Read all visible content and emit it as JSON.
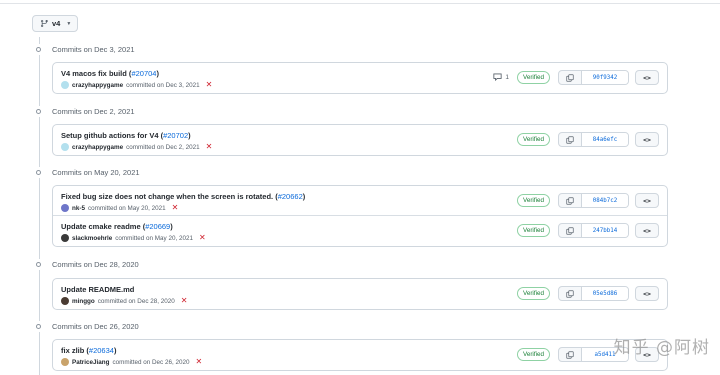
{
  "branch": {
    "label": "v4"
  },
  "groups": [
    {
      "date": "Commits on Dec 3, 2021",
      "commits": [
        {
          "title": "V4 macos fix build (",
          "pr": "#20704",
          "close": ")",
          "author": "crazyhappygame",
          "committed": "committed on Dec 3, 2021",
          "comments": "1",
          "verified": "Verified",
          "sha": "90f9342",
          "browse": "<>"
        }
      ]
    },
    {
      "date": "Commits on Dec 2, 2021",
      "commits": [
        {
          "title": "Setup github actions for V4 (",
          "pr": "#20702",
          "close": ")",
          "author": "crazyhappygame",
          "committed": "committed on Dec 2, 2021",
          "verified": "Verified",
          "sha": "84a6efc",
          "browse": "<>"
        }
      ]
    },
    {
      "date": "Commits on May 20, 2021",
      "commits": [
        {
          "title": "Fixed bug size does not change when the screen is rotated. (",
          "pr": "#20662",
          "close": ")",
          "author": "nk-5",
          "committed": "committed on May 20, 2021",
          "verified": "Verified",
          "sha": "084b7c2",
          "browse": "<>"
        },
        {
          "title": "Update cmake readme (",
          "pr": "#20669",
          "close": ")",
          "author": "slackmoehrle",
          "committed": "committed on May 20, 2021",
          "verified": "Verified",
          "sha": "247bb14",
          "browse": "<>"
        }
      ]
    },
    {
      "date": "Commits on Dec 28, 2020",
      "commits": [
        {
          "title": "Update README.md",
          "pr": "",
          "close": "",
          "author": "minggo",
          "committed": "committed on Dec 28, 2020",
          "verified": "Verified",
          "sha": "05e5d86",
          "browse": "<>"
        }
      ]
    },
    {
      "date": "Commits on Dec 26, 2020",
      "commits": [
        {
          "title": "fix zlib (",
          "pr": "#20634",
          "close": ")",
          "author": "PatriceJiang",
          "committed": "committed on Dec 26, 2020",
          "verified": "Verified",
          "sha": "a5d411",
          "browse": "<>"
        }
      ]
    }
  ],
  "watermark": "知乎 @阿树",
  "colors": {
    "link": "#0969da",
    "verified": "#1a7f37",
    "fail": "#cf222e",
    "border": "#d0d7de"
  },
  "icons": {
    "branch": "git-branch-icon",
    "copy": "copy-icon",
    "comment": "comment-icon",
    "fail": "x-fail-icon"
  }
}
